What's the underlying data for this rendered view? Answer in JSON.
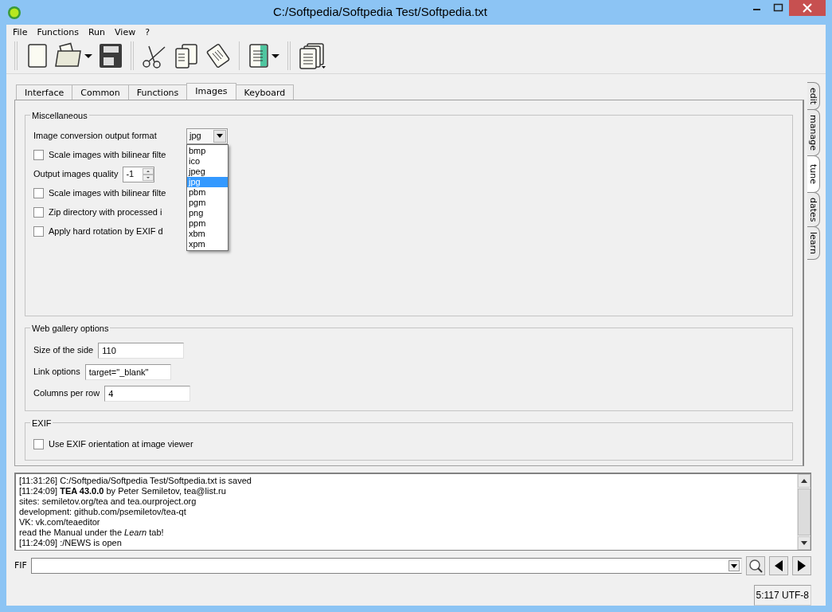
{
  "window": {
    "title": "C:/Softpedia/Softpedia Test/Softpedia.txt"
  },
  "menu": [
    "File",
    "Functions",
    "Run",
    "View",
    "?"
  ],
  "tabs": [
    {
      "label": "Interface",
      "selected": false
    },
    {
      "label": "Common",
      "selected": false
    },
    {
      "label": "Functions",
      "selected": false
    },
    {
      "label": "Images",
      "selected": true
    },
    {
      "label": "Keyboard",
      "selected": false
    }
  ],
  "side_tabs": [
    {
      "label": "edit",
      "selected": false
    },
    {
      "label": "manage",
      "selected": false
    },
    {
      "label": "tune",
      "selected": true
    },
    {
      "label": "dates",
      "selected": false
    },
    {
      "label": "learn",
      "selected": false
    }
  ],
  "miscellaneous": {
    "title": "Miscellaneous",
    "rows": [
      {
        "kind": "combo",
        "label": "Image conversion output format",
        "value": "jpg",
        "expanded": true
      },
      {
        "kind": "checkbox",
        "label": "Scale images with bilinear filte",
        "checked": false
      },
      {
        "kind": "spin",
        "label": "Output images quality",
        "value": "-1"
      },
      {
        "kind": "checkbox",
        "label": "Scale images with bilinear filte",
        "checked": false
      },
      {
        "kind": "checkbox",
        "label": "Zip directory with processed i",
        "checked": false
      },
      {
        "kind": "checkbox",
        "label": "Apply hard rotation by EXIF d",
        "checked": false
      }
    ]
  },
  "dropdown": {
    "items": [
      {
        "label": "bmp",
        "selected": false
      },
      {
        "label": "ico",
        "selected": false
      },
      {
        "label": "jpeg",
        "selected": false
      },
      {
        "label": "jpg",
        "selected": true
      },
      {
        "label": "pbm",
        "selected": false
      },
      {
        "label": "pgm",
        "selected": false
      },
      {
        "label": "png",
        "selected": false
      },
      {
        "label": "ppm",
        "selected": false
      },
      {
        "label": "xbm",
        "selected": false
      },
      {
        "label": "xpm",
        "selected": false
      }
    ]
  },
  "web_gallery": {
    "title": "Web gallery options",
    "fields": [
      {
        "label": "Size of the side",
        "value": "110"
      },
      {
        "label": "Link options",
        "value": "target=\"_blank\""
      },
      {
        "label": "Columns per row",
        "value": "4"
      }
    ]
  },
  "exif": {
    "title": "EXIF",
    "checkbox": {
      "label": "Use EXIF orientation at image viewer",
      "checked": false
    }
  },
  "log": {
    "lines": [
      "[11:31:26] C:/Softpedia/Softpedia Test/Softpedia.txt is saved",
      "[11:24:09] **TEA 43.0.0** by Peter Semiletov, tea@list.ru",
      "sites: semiletov.org/tea and tea.ourproject.org",
      "development: github.com/psemiletov/tea-qt",
      "VK: vk.com/teaeditor",
      "read the Manual under the *Learn* tab!",
      "[11:24:09] :/NEWS is open"
    ]
  },
  "fif": {
    "label": "FIF"
  },
  "status_bar": {
    "position": "5:117 UTF-8"
  }
}
